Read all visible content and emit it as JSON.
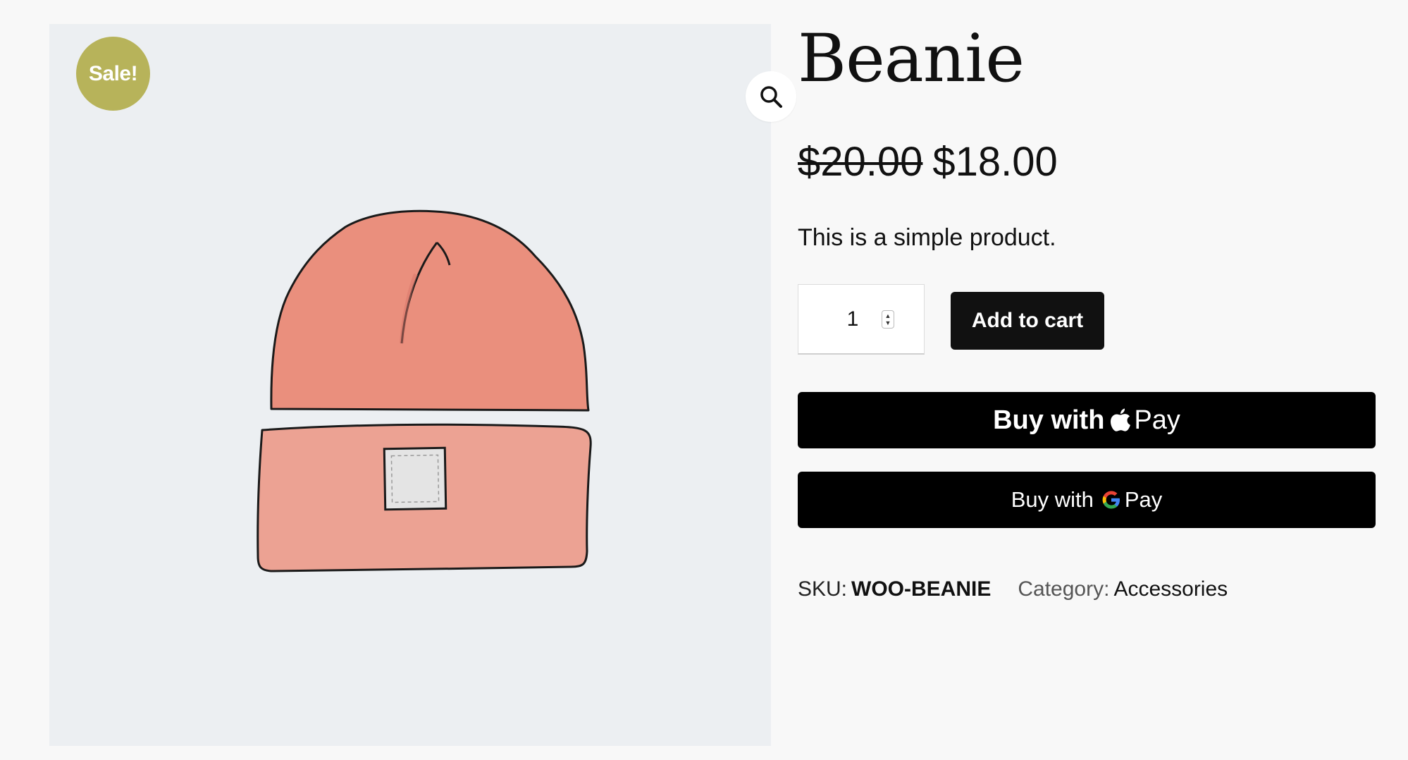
{
  "product": {
    "title": "Beanie",
    "sale_badge": "Sale!",
    "price_regular": "$20.00",
    "price_sale": "$18.00",
    "description": "This is a simple product.",
    "quantity": "1",
    "add_to_cart_label": "Add to cart",
    "apple_pay": {
      "prefix": "Buy with",
      "word": "Pay"
    },
    "google_pay": {
      "prefix": "Buy with",
      "word": "Pay"
    },
    "meta": {
      "sku_label": "SKU:",
      "sku_value": "WOO-BEANIE",
      "category_label": "Category:",
      "category_value": "Accessories"
    }
  },
  "icons": [
    "search-icon",
    "apple-logo-icon",
    "google-g-icon",
    "quantity-spinner-icon"
  ],
  "colors": {
    "background": "#f8f8f8",
    "gallery_background": "#eceff2",
    "sale_badge": "#b7b35a",
    "button": "#111111",
    "beanie": "#e99a88"
  }
}
